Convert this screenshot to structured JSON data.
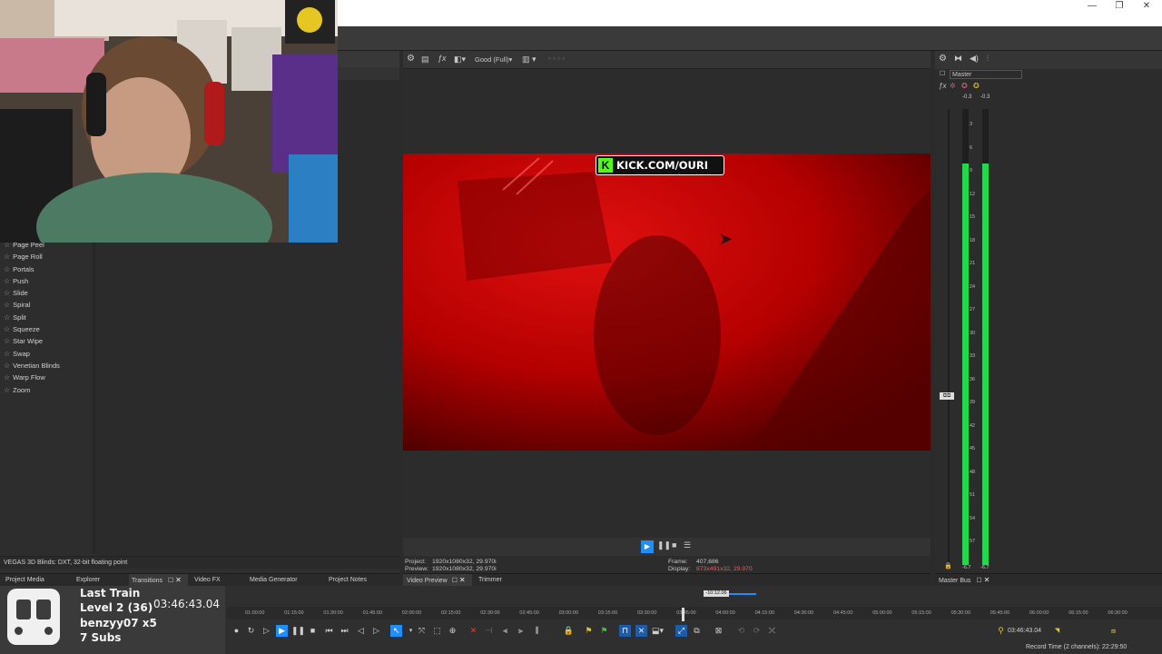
{
  "window": {
    "minimize": "—",
    "restore": "❐",
    "close": "✕"
  },
  "transitions": {
    "items": [
      "Page Peel",
      "Page Roll",
      "Portals",
      "Push",
      "Slide",
      "Spiral",
      "Split",
      "Squeeze",
      "Star Wipe",
      "Swap",
      "Venetian Blinds",
      "Warp Flow",
      "Zoom"
    ],
    "status": "VEGAS 3D Blinds: DXT, 32-bit floating point"
  },
  "left_tabs": {
    "project_media": "Project Media",
    "explorer": "Explorer",
    "transitions": "Transitions",
    "video_fx": "Video FX",
    "media_generator": "Media Generator",
    "project_notes": "Project Notes"
  },
  "preview": {
    "quality": "Good (Full)",
    "overlay_text": "KICK.COM/OURI",
    "overlay_k": "K",
    "project_label": "Project:",
    "project_value": "1920x1080x32, 29.970i",
    "preview_label": "Preview:",
    "preview_value": "1920x1080x32, 29.970i",
    "frame_label": "Frame:",
    "frame_value": "407,686",
    "display_label": "Display:",
    "display_value": "873x491x32, 29.970",
    "tab_video_preview": "Video Preview",
    "tab_trimmer": "Trimmer",
    "tabx": "✕"
  },
  "master": {
    "title": "Master",
    "peak_left": "-0.3",
    "peak_right": "-0.3",
    "scale": [
      "3",
      "6",
      "9",
      "12",
      "15",
      "18",
      "21",
      "24",
      "27",
      "30",
      "33",
      "36",
      "39",
      "42",
      "45",
      "48",
      "51",
      "54",
      "57"
    ],
    "bottom_left": "-6.7",
    "bottom_right": "-6.7",
    "tab": "Master Bus",
    "tabx": "✕",
    "level_left": 0.88,
    "level_right": 0.88,
    "meter_color": "#23d84a"
  },
  "timeline": {
    "ruler": [
      "01:00:00",
      "01:15:00",
      "01:30:00",
      "01:45:00",
      "02:00:00",
      "02:15:00",
      "02:30:00",
      "02:45:00",
      "03:00:00",
      "03:15:00",
      "03:30:00",
      "03:45:00",
      "04:00:00",
      "04:15:00",
      "04:30:00",
      "04:45:00",
      "05:00:00",
      "05:15:00",
      "05:30:00",
      "05:45:00",
      "06:00:00",
      "06:15:00",
      "06:30:00"
    ],
    "marker": "-10:12.06",
    "cursor_time": "03:46:43.04",
    "record_time": "Record Time (2 channels): 22:29:50"
  },
  "stream_overlay": {
    "song": "Last Train",
    "level": "Level 2  (36)",
    "time": "03:46:43.04",
    "user": "benzyy07 x5",
    "subs": "7 Subs"
  },
  "colors": {
    "accent": "#1e8fff",
    "video_red": "#c80000",
    "kick_green": "#53fc18"
  }
}
